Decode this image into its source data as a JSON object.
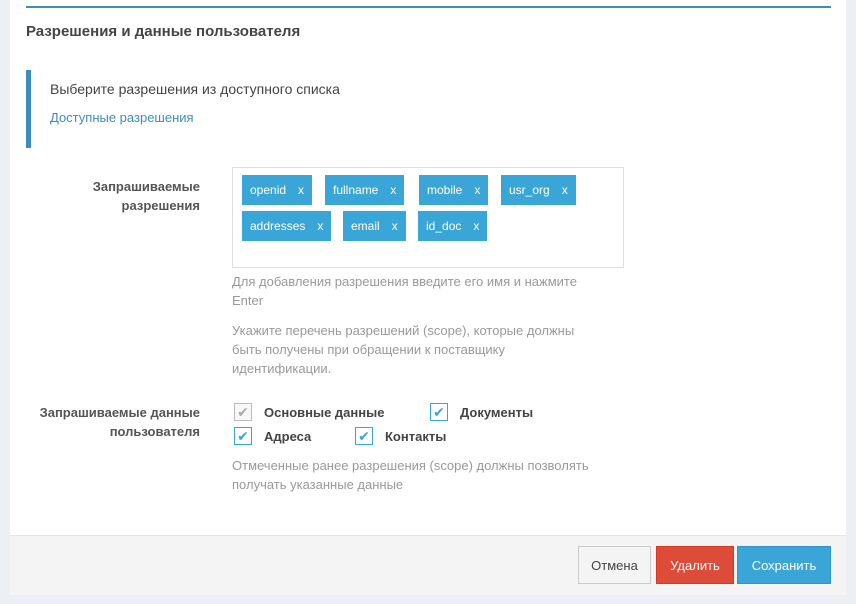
{
  "section_title": "Разрешения и данные пользователя",
  "callout": {
    "text": "Выберите разрешения из доступного списка",
    "link": "Доступные разрешения"
  },
  "scopes": {
    "label_line1": "Запрашиваемые",
    "label_line2": "разрешения",
    "tags": [
      "openid",
      "fullname",
      "mobile",
      "usr_org",
      "addresses",
      "email",
      "id_doc"
    ],
    "remove_symbol": "x",
    "help1_line1": "Для добавления разрешения введите его имя и нажмите",
    "help1_line2": "Enter",
    "help2_line1": "Укажите перечень разрешений (scope), которые должны",
    "help2_line2": "быть получены при обращении к поставщику",
    "help2_line3": "идентификации."
  },
  "userdata": {
    "label_line1": "Запрашиваемые данные",
    "label_line2": "пользователя",
    "checkboxes": [
      {
        "label": "Основные данные",
        "checked": true,
        "disabled": true
      },
      {
        "label": "Документы",
        "checked": true,
        "disabled": false
      },
      {
        "label": "Адреса",
        "checked": true,
        "disabled": false
      },
      {
        "label": "Контакты",
        "checked": true,
        "disabled": false
      }
    ],
    "help_line1": "Отмеченные ранее разрешения (scope) должны позволять",
    "help_line2": "получать указанные данные"
  },
  "footer": {
    "cancel": "Отмена",
    "delete": "Удалить",
    "save": "Сохранить"
  },
  "colors": {
    "accent": "#3aa6d8",
    "danger": "#dd4b39"
  }
}
